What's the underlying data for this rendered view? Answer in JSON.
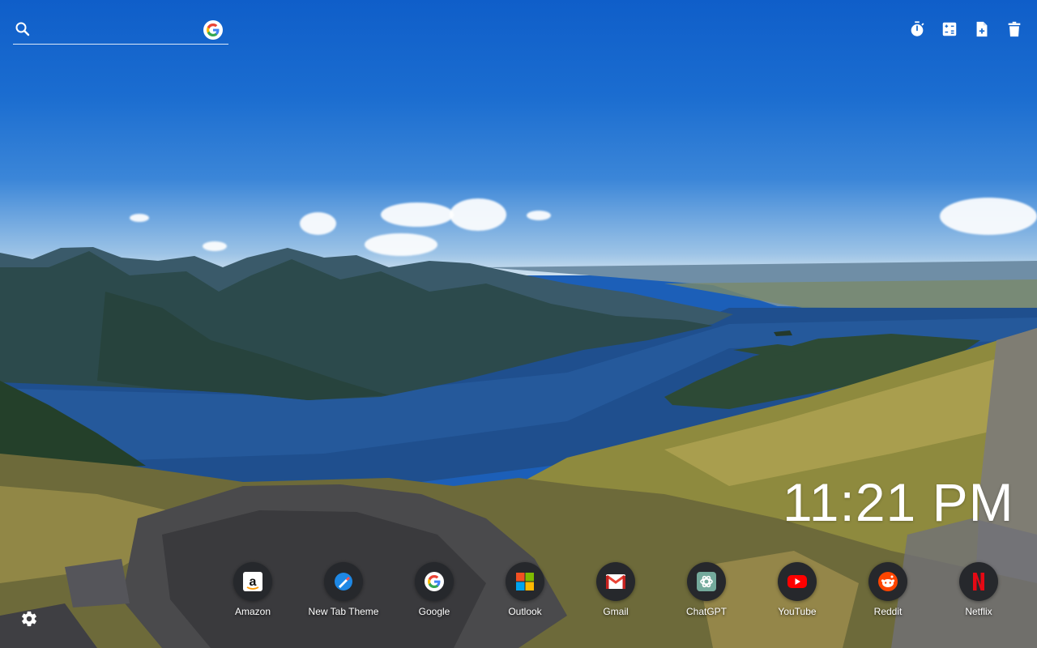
{
  "search": {
    "placeholder": "",
    "value": "",
    "icon": "search-icon",
    "engine_icon": "google-icon"
  },
  "toolbar": {
    "items": [
      {
        "name": "timer",
        "icon": "stopwatch-icon"
      },
      {
        "name": "calculator",
        "icon": "calculator-icon"
      },
      {
        "name": "new-note",
        "icon": "add-note-icon"
      },
      {
        "name": "trash",
        "icon": "trash-icon"
      }
    ]
  },
  "clock": {
    "time": "11:21 PM"
  },
  "shortcuts": [
    {
      "label": "Amazon",
      "icon": "amazon-icon"
    },
    {
      "label": "New Tab Theme",
      "icon": "new-tab-theme-icon"
    },
    {
      "label": "Google",
      "icon": "google-icon"
    },
    {
      "label": "Outlook",
      "icon": "microsoft-icon"
    },
    {
      "label": "Gmail",
      "icon": "gmail-icon"
    },
    {
      "label": "ChatGPT",
      "icon": "chatgpt-icon"
    },
    {
      "label": "YouTube",
      "icon": "youtube-icon"
    },
    {
      "label": "Reddit",
      "icon": "reddit-icon"
    },
    {
      "label": "Netflix",
      "icon": "netflix-icon"
    }
  ],
  "settings": {
    "icon": "gear-icon"
  },
  "colors": {
    "sky": "#1b6dd0",
    "lake": "#1e4f8f",
    "shortcut_bg": "#26282c"
  }
}
